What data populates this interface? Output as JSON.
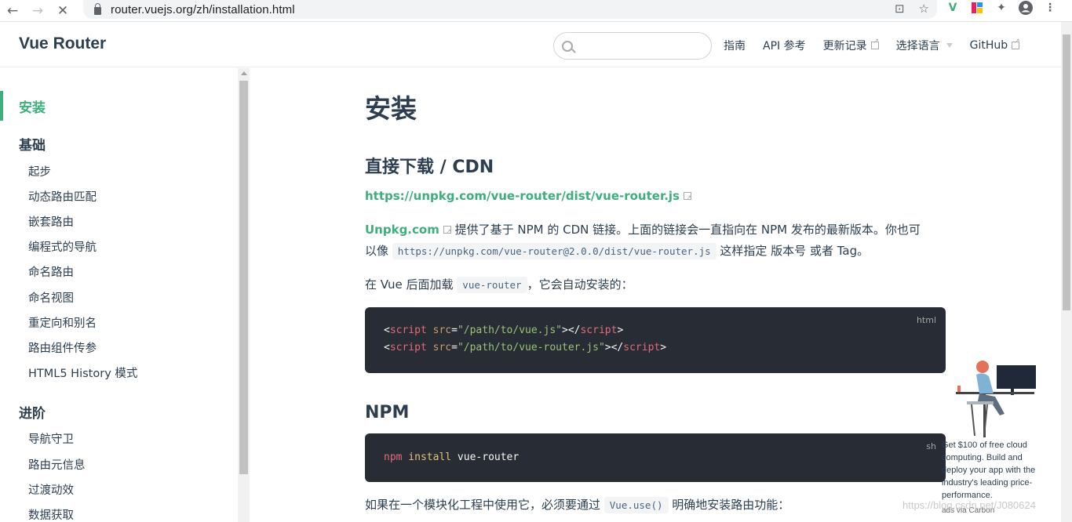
{
  "browser": {
    "url": "router.vuejs.org/zh/installation.html",
    "back_icon": "←",
    "forward_icon": "→",
    "reload_icon": "✕"
  },
  "header": {
    "logo": "Vue Router",
    "search_placeholder": "",
    "nav": [
      {
        "label": "指南",
        "external": false
      },
      {
        "label": "API 参考",
        "external": false
      },
      {
        "label": "更新记录",
        "external": true
      },
      {
        "label": "选择语言",
        "dropdown": true
      },
      {
        "label": "GitHub",
        "external": true
      }
    ]
  },
  "sidebar": {
    "active": "安装",
    "groups": [
      {
        "title": "基础",
        "items": [
          "起步",
          "动态路由匹配",
          "嵌套路由",
          "编程式的导航",
          "命名路由",
          "命名视图",
          "重定向和别名",
          "路由组件传参",
          "HTML5 History 模式"
        ]
      },
      {
        "title": "进阶",
        "items": [
          "导航守卫",
          "路由元信息",
          "过渡动效",
          "数据获取"
        ]
      }
    ]
  },
  "content": {
    "title": "安装",
    "section1_title": "直接下载 / CDN",
    "cdn_link": "https://unpkg.com/vue-router/dist/vue-router.js",
    "p1_link": "Unpkg.com",
    "p1_text_a": " 提供了基于 NPM 的 CDN 链接。上面的链接会一直指向在 NPM 发布的最新版本。你也可",
    "p1_text_b": "以像 ",
    "p1_code": "https://unpkg.com/vue-router@2.0.0/dist/vue-router.js",
    "p1_text_c": " 这样指定 版本号 或者 Tag。",
    "p2_text_a": "在 Vue 后面加载 ",
    "p2_code": "vue-router",
    "p2_text_b": "，它会自动安装的：",
    "code1_lang": "html",
    "code1_line1": {
      "open": "<",
      "tag": "script",
      "attr": " src",
      "eq": "=",
      "str": "\"/path/to/vue.js\"",
      "close": "></",
      "tag2": "script",
      "end": ">"
    },
    "code1_line2": {
      "open": "<",
      "tag": "script",
      "attr": " src",
      "eq": "=",
      "str": "\"/path/to/vue-router.js\"",
      "close": "></",
      "tag2": "script",
      "end": ">"
    },
    "section2_title": "NPM",
    "code2_lang": "sh",
    "code2_cmd": "npm",
    "code2_kw": " install",
    "code2_arg": " vue-router",
    "p3_text_a": "如果在一个模块化工程中使用它，必须要通过 ",
    "p3_code": "Vue.use()",
    "p3_text_b": " 明确地安装路由功能："
  },
  "ad": {
    "text": "Get $100 of free cloud computing. Build and deploy your app with the industry's leading price-performance.",
    "via": "ads via Carbon"
  },
  "watermark": "https://blog.csdn.net/J080624",
  "colors": {
    "accent": "#3eaf7c",
    "text": "#2c3e50",
    "code_bg": "#282c34"
  }
}
